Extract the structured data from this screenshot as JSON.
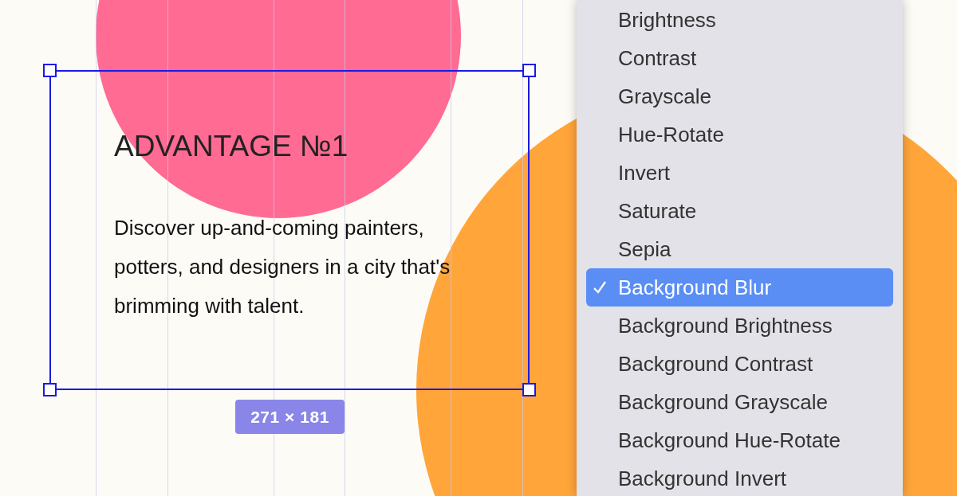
{
  "canvas": {
    "heading": "ADVANTAGE №1",
    "paragraph": "Discover up-and-coming painters, potters, and designers in a city that's brimming with talent.",
    "size_badge": "271 × 181"
  },
  "menu": {
    "items": [
      {
        "label": "Brightness",
        "selected": false
      },
      {
        "label": "Contrast",
        "selected": false
      },
      {
        "label": "Grayscale",
        "selected": false
      },
      {
        "label": "Hue-Rotate",
        "selected": false
      },
      {
        "label": "Invert",
        "selected": false
      },
      {
        "label": "Saturate",
        "selected": false
      },
      {
        "label": "Sepia",
        "selected": false
      },
      {
        "label": "Background Blur",
        "selected": true
      },
      {
        "label": "Background Brightness",
        "selected": false
      },
      {
        "label": "Background Contrast",
        "selected": false
      },
      {
        "label": "Background Grayscale",
        "selected": false
      },
      {
        "label": "Background Hue-Rotate",
        "selected": false
      },
      {
        "label": "Background Invert",
        "selected": false
      }
    ]
  }
}
